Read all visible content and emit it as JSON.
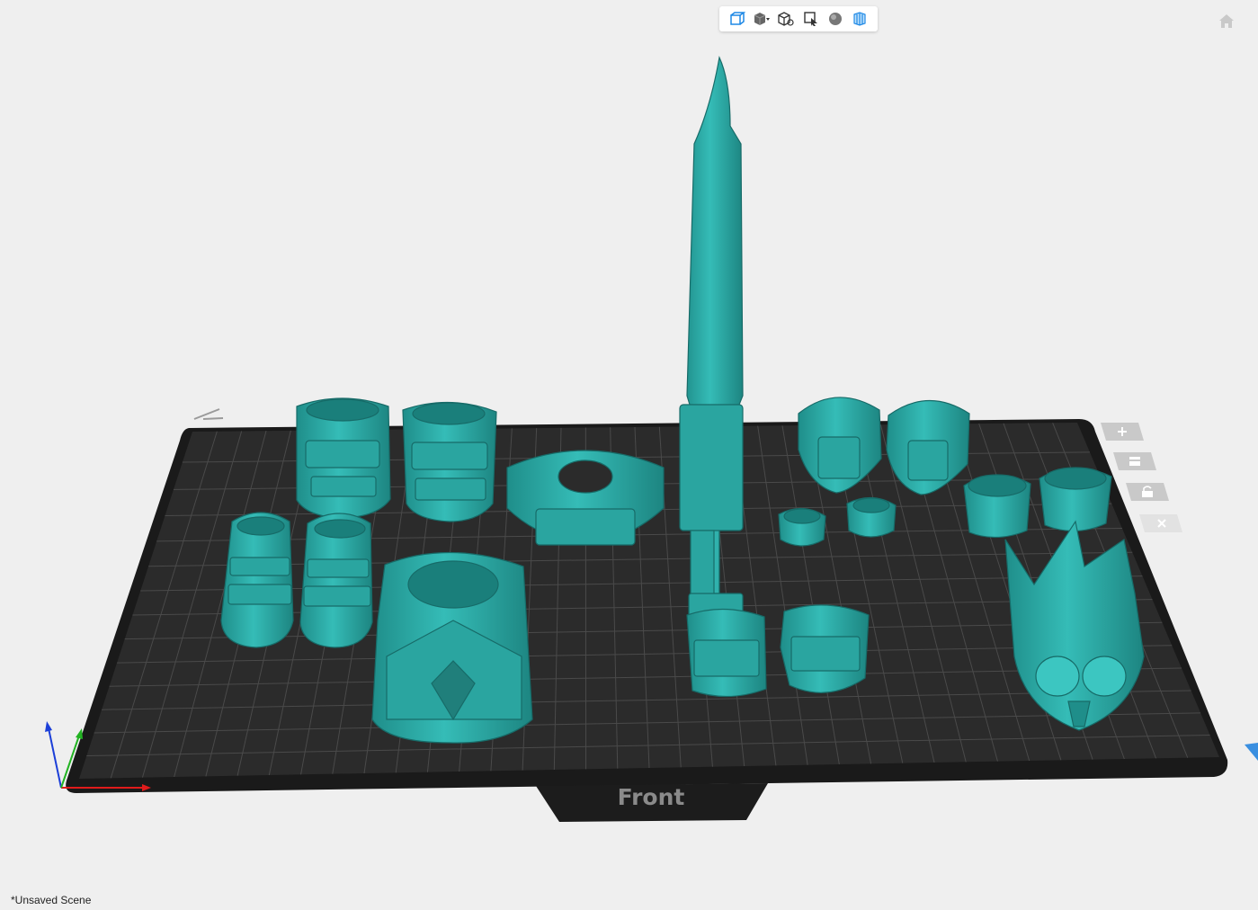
{
  "toolbar": {
    "items": [
      {
        "icon": "perspective-cube-icon"
      },
      {
        "icon": "solid-cube-dropdown-icon"
      },
      {
        "icon": "wireframe-cube-icon"
      },
      {
        "icon": "select-region-icon"
      },
      {
        "icon": "sphere-shading-icon"
      },
      {
        "icon": "slice-layers-icon"
      }
    ]
  },
  "plate": {
    "front_label": "Front",
    "bed_color": "#2b2b2b",
    "grid_color": "#4a4a4a"
  },
  "model": {
    "color": "#2ea7a3"
  },
  "side_toolbar": {
    "items": [
      {
        "icon": "plus-icon"
      },
      {
        "icon": "layout-icon"
      },
      {
        "icon": "unlock-icon"
      },
      {
        "icon": "close-icon"
      }
    ]
  },
  "status": {
    "scene": "*Unsaved Scene"
  }
}
